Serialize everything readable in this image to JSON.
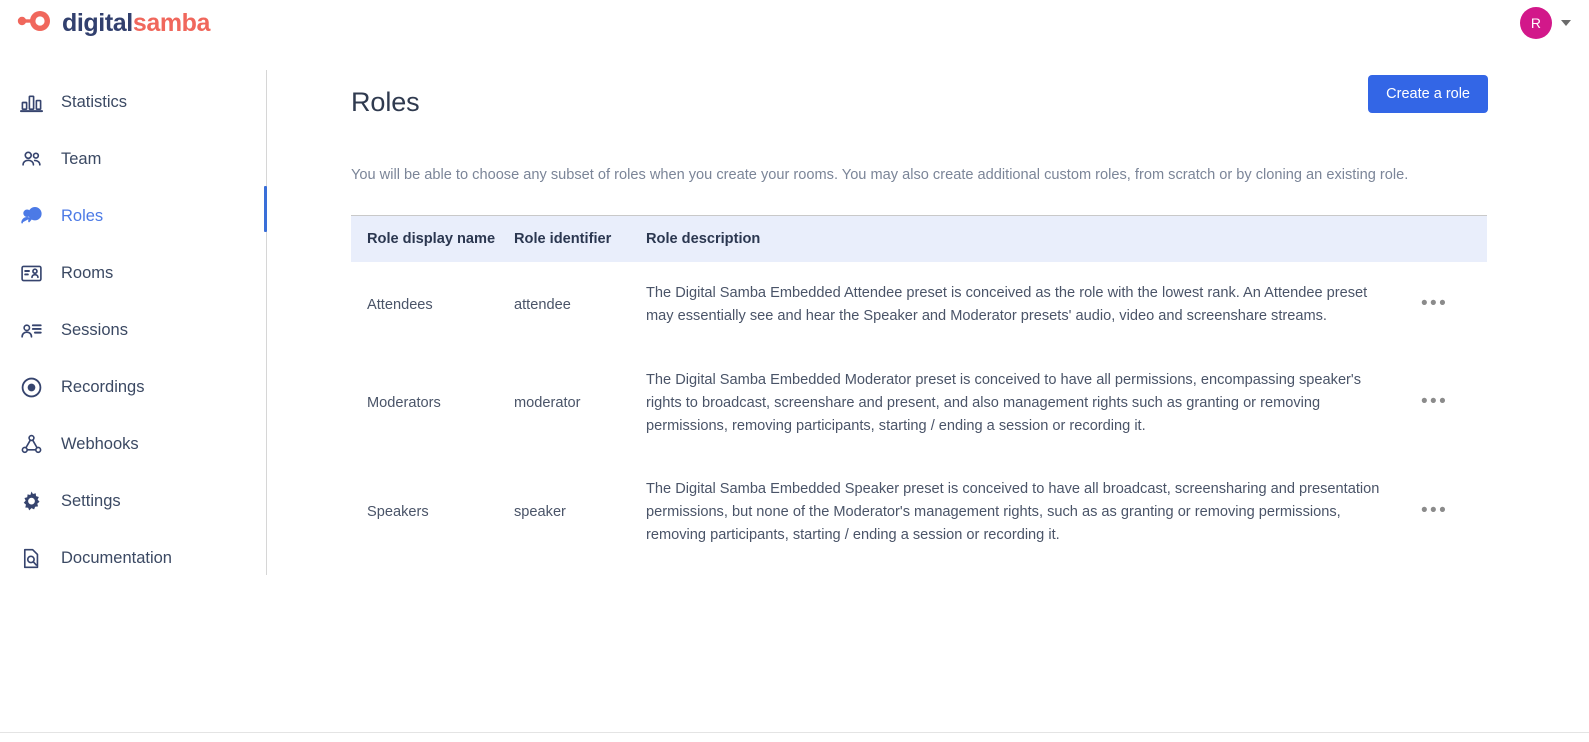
{
  "brand": {
    "word1": "digital",
    "word2": "samba",
    "logo_icon": "digital-samba-logo-icon",
    "color_dark": "#32406e",
    "color_accent": "#f0675c"
  },
  "topbar": {
    "avatar_initial": "R",
    "avatar_color": "#d2188a",
    "caret_icon": "chevron-down-icon"
  },
  "sidebar": {
    "items": [
      {
        "label": "Statistics",
        "icon": "bar-chart-icon",
        "active": false
      },
      {
        "label": "Team",
        "icon": "users-icon",
        "active": false
      },
      {
        "label": "Roles",
        "icon": "user-check-icon",
        "active": true
      },
      {
        "label": "Rooms",
        "icon": "id-card-icon",
        "active": false
      },
      {
        "label": "Sessions",
        "icon": "user-list-icon",
        "active": false
      },
      {
        "label": "Recordings",
        "icon": "record-dot-icon",
        "active": false
      },
      {
        "label": "Webhooks",
        "icon": "webhook-icon",
        "active": false
      },
      {
        "label": "Settings",
        "icon": "gear-icon",
        "active": false
      },
      {
        "label": "Documentation",
        "icon": "doc-search-icon",
        "active": false
      }
    ],
    "active_color": "#4c7ae6"
  },
  "page": {
    "title": "Roles",
    "create_button_label": "Create a role",
    "create_button_color": "#3366e6",
    "subtitle": "You will be able to choose any subset of roles when you create your rooms. You may also create additional custom roles, from scratch or by cloning an existing role."
  },
  "table": {
    "header_bg": "#e9eefb",
    "columns": [
      "Role display name",
      "Role identifier",
      "Role description"
    ],
    "row_menu_icon": "ellipsis-horizontal-icon",
    "row_menu_label": "•••",
    "rows": [
      {
        "display_name": "Attendees",
        "identifier": "attendee",
        "description": "The Digital Samba Embedded Attendee preset is conceived as the role with the lowest rank. An Attendee preset may essentially see and hear the Speaker and Moderator presets' audio, video and screenshare streams."
      },
      {
        "display_name": "Moderators",
        "identifier": "moderator",
        "description": "The Digital Samba Embedded Moderator preset is conceived to have all permissions, encompassing speaker's rights to broadcast, screenshare and present, and also management rights such as granting or removing permissions, removing participants, starting / ending a session or recording it."
      },
      {
        "display_name": "Speakers",
        "identifier": "speaker",
        "description": "The Digital Samba Embedded Speaker preset is conceived to have all broadcast, screensharing and presentation permissions, but none of the Moderator's management rights, such as as granting or removing permissions, removing participants, starting / ending a session or recording it."
      }
    ]
  }
}
